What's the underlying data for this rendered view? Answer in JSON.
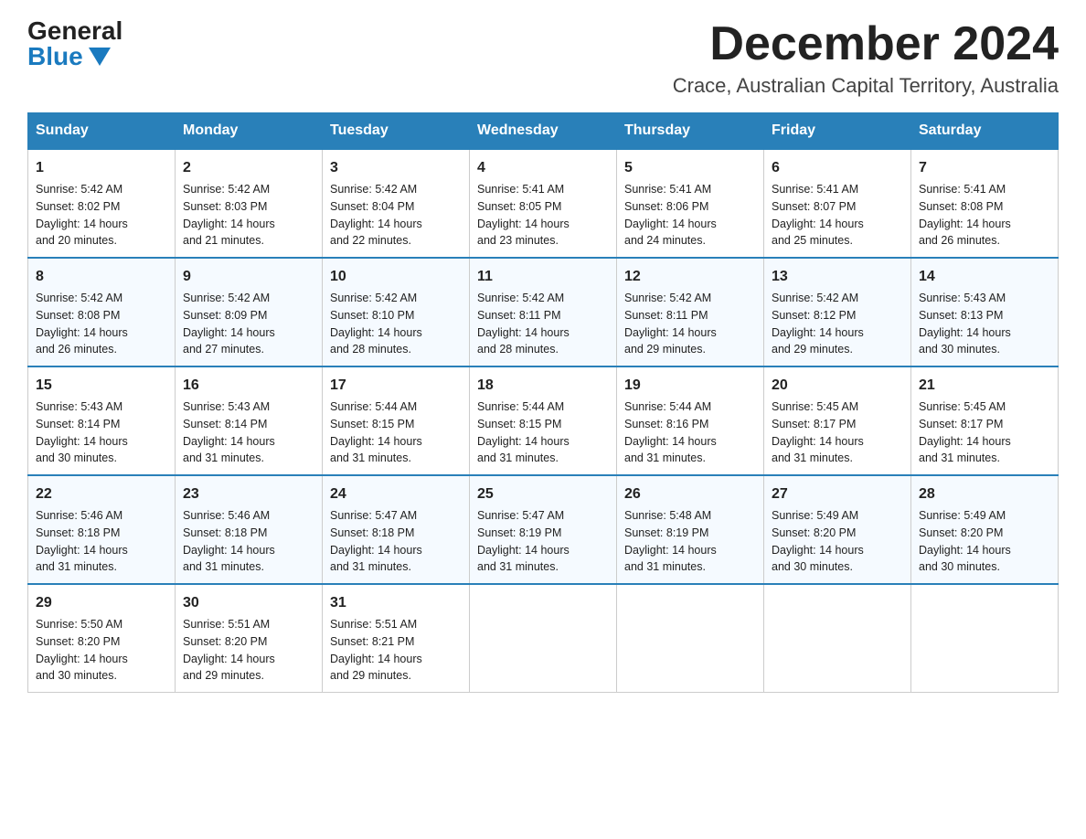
{
  "logo": {
    "general": "General",
    "blue": "Blue"
  },
  "title": "December 2024",
  "location": "Crace, Australian Capital Territory, Australia",
  "days_of_week": [
    "Sunday",
    "Monday",
    "Tuesday",
    "Wednesday",
    "Thursday",
    "Friday",
    "Saturday"
  ],
  "weeks": [
    [
      {
        "day": "1",
        "sunrise": "5:42 AM",
        "sunset": "8:02 PM",
        "daylight": "14 hours and 20 minutes."
      },
      {
        "day": "2",
        "sunrise": "5:42 AM",
        "sunset": "8:03 PM",
        "daylight": "14 hours and 21 minutes."
      },
      {
        "day": "3",
        "sunrise": "5:42 AM",
        "sunset": "8:04 PM",
        "daylight": "14 hours and 22 minutes."
      },
      {
        "day": "4",
        "sunrise": "5:41 AM",
        "sunset": "8:05 PM",
        "daylight": "14 hours and 23 minutes."
      },
      {
        "day": "5",
        "sunrise": "5:41 AM",
        "sunset": "8:06 PM",
        "daylight": "14 hours and 24 minutes."
      },
      {
        "day": "6",
        "sunrise": "5:41 AM",
        "sunset": "8:07 PM",
        "daylight": "14 hours and 25 minutes."
      },
      {
        "day": "7",
        "sunrise": "5:41 AM",
        "sunset": "8:08 PM",
        "daylight": "14 hours and 26 minutes."
      }
    ],
    [
      {
        "day": "8",
        "sunrise": "5:42 AM",
        "sunset": "8:08 PM",
        "daylight": "14 hours and 26 minutes."
      },
      {
        "day": "9",
        "sunrise": "5:42 AM",
        "sunset": "8:09 PM",
        "daylight": "14 hours and 27 minutes."
      },
      {
        "day": "10",
        "sunrise": "5:42 AM",
        "sunset": "8:10 PM",
        "daylight": "14 hours and 28 minutes."
      },
      {
        "day": "11",
        "sunrise": "5:42 AM",
        "sunset": "8:11 PM",
        "daylight": "14 hours and 28 minutes."
      },
      {
        "day": "12",
        "sunrise": "5:42 AM",
        "sunset": "8:11 PM",
        "daylight": "14 hours and 29 minutes."
      },
      {
        "day": "13",
        "sunrise": "5:42 AM",
        "sunset": "8:12 PM",
        "daylight": "14 hours and 29 minutes."
      },
      {
        "day": "14",
        "sunrise": "5:43 AM",
        "sunset": "8:13 PM",
        "daylight": "14 hours and 30 minutes."
      }
    ],
    [
      {
        "day": "15",
        "sunrise": "5:43 AM",
        "sunset": "8:14 PM",
        "daylight": "14 hours and 30 minutes."
      },
      {
        "day": "16",
        "sunrise": "5:43 AM",
        "sunset": "8:14 PM",
        "daylight": "14 hours and 31 minutes."
      },
      {
        "day": "17",
        "sunrise": "5:44 AM",
        "sunset": "8:15 PM",
        "daylight": "14 hours and 31 minutes."
      },
      {
        "day": "18",
        "sunrise": "5:44 AM",
        "sunset": "8:15 PM",
        "daylight": "14 hours and 31 minutes."
      },
      {
        "day": "19",
        "sunrise": "5:44 AM",
        "sunset": "8:16 PM",
        "daylight": "14 hours and 31 minutes."
      },
      {
        "day": "20",
        "sunrise": "5:45 AM",
        "sunset": "8:17 PM",
        "daylight": "14 hours and 31 minutes."
      },
      {
        "day": "21",
        "sunrise": "5:45 AM",
        "sunset": "8:17 PM",
        "daylight": "14 hours and 31 minutes."
      }
    ],
    [
      {
        "day": "22",
        "sunrise": "5:46 AM",
        "sunset": "8:18 PM",
        "daylight": "14 hours and 31 minutes."
      },
      {
        "day": "23",
        "sunrise": "5:46 AM",
        "sunset": "8:18 PM",
        "daylight": "14 hours and 31 minutes."
      },
      {
        "day": "24",
        "sunrise": "5:47 AM",
        "sunset": "8:18 PM",
        "daylight": "14 hours and 31 minutes."
      },
      {
        "day": "25",
        "sunrise": "5:47 AM",
        "sunset": "8:19 PM",
        "daylight": "14 hours and 31 minutes."
      },
      {
        "day": "26",
        "sunrise": "5:48 AM",
        "sunset": "8:19 PM",
        "daylight": "14 hours and 31 minutes."
      },
      {
        "day": "27",
        "sunrise": "5:49 AM",
        "sunset": "8:20 PM",
        "daylight": "14 hours and 30 minutes."
      },
      {
        "day": "28",
        "sunrise": "5:49 AM",
        "sunset": "8:20 PM",
        "daylight": "14 hours and 30 minutes."
      }
    ],
    [
      {
        "day": "29",
        "sunrise": "5:50 AM",
        "sunset": "8:20 PM",
        "daylight": "14 hours and 30 minutes."
      },
      {
        "day": "30",
        "sunrise": "5:51 AM",
        "sunset": "8:20 PM",
        "daylight": "14 hours and 29 minutes."
      },
      {
        "day": "31",
        "sunrise": "5:51 AM",
        "sunset": "8:21 PM",
        "daylight": "14 hours and 29 minutes."
      },
      null,
      null,
      null,
      null
    ]
  ],
  "labels": {
    "sunrise": "Sunrise:",
    "sunset": "Sunset:",
    "daylight": "Daylight:"
  }
}
